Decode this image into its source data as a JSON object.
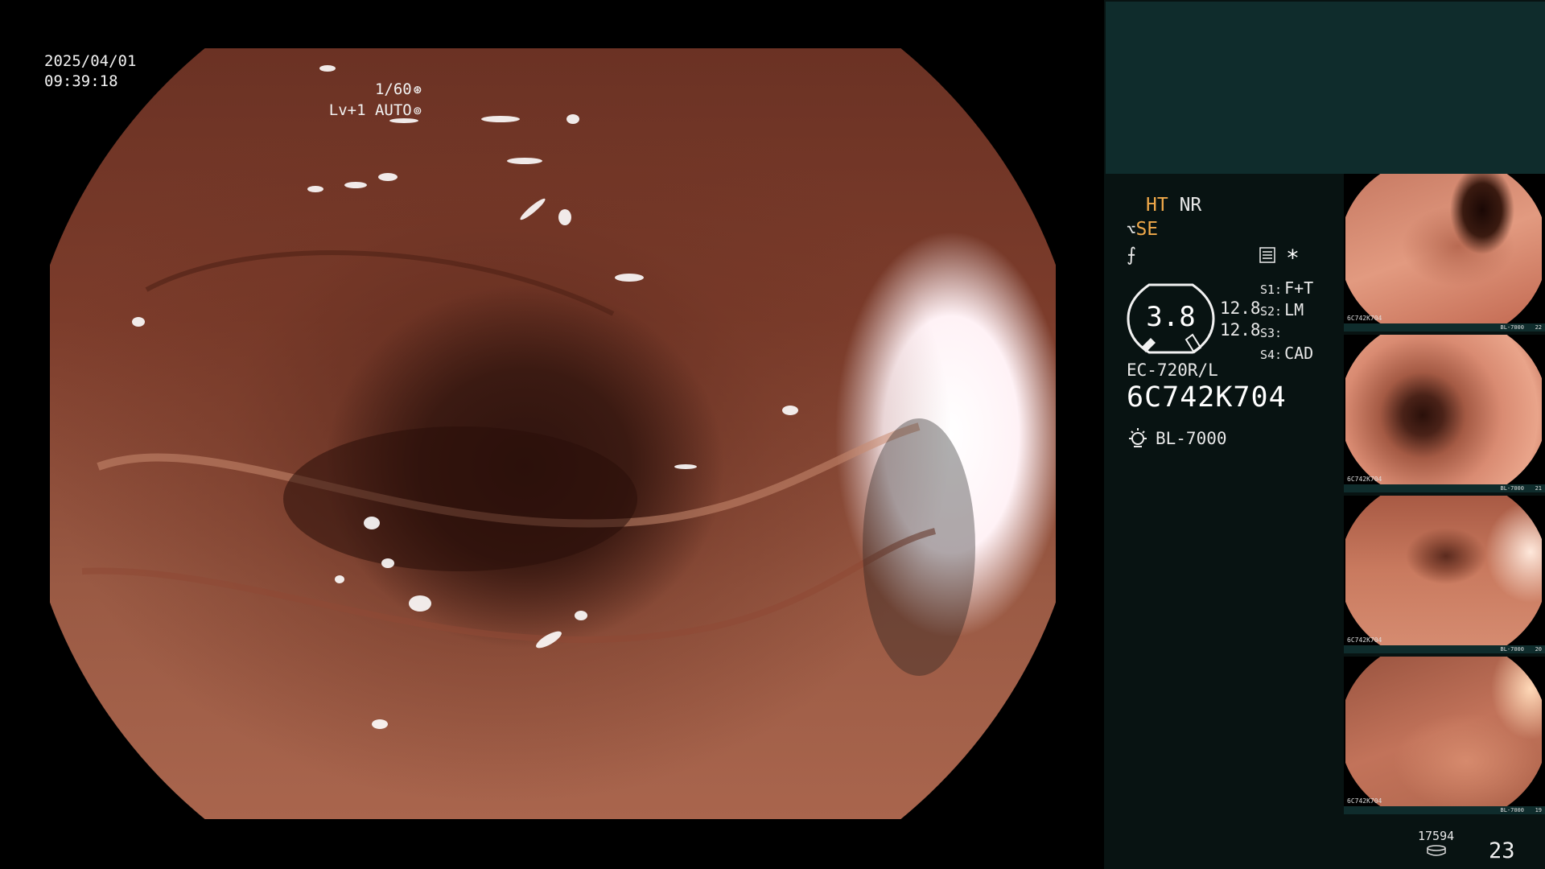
{
  "timestamp": {
    "date": "2025/04/01",
    "time": "09:39:18"
  },
  "video": {
    "shutter": "1/60",
    "level": "Lv+1",
    "iris_mode": "AUTO"
  },
  "image_processing": {
    "ht_label": "HT",
    "nr_label": "NR",
    "se_label": "SE",
    "fs_label": "⨍",
    "asterisk": "*"
  },
  "gauge": {
    "value": "3.8",
    "reading_1": "12.8",
    "reading_2": "12.8"
  },
  "scope_settings": [
    {
      "key": "S1:",
      "value": "F+T"
    },
    {
      "key": "S2:",
      "value": "LM"
    },
    {
      "key": "S3:",
      "value": ""
    },
    {
      "key": "S4:",
      "value": "CAD"
    }
  ],
  "scope": {
    "model": "EC-720R/L",
    "serial": "6C742K704"
  },
  "light_source": {
    "model": "BL-7000",
    "icon": "light-bulb-icon"
  },
  "thumbnails": [
    {
      "serial": "6C742K704",
      "lamp": "BL-7000",
      "index": "22"
    },
    {
      "serial": "6C742K704",
      "lamp": "BL-7000",
      "index": "21"
    },
    {
      "serial": "6C742K704",
      "lamp": "BL-7000",
      "index": "20"
    },
    {
      "serial": "6C742K704",
      "lamp": "BL-7000",
      "index": "19"
    }
  ],
  "footer": {
    "storage_count": "17594",
    "page_number": "23"
  },
  "colors": {
    "accent_orange": "#f0a94a",
    "panel_teal": "#0f2c2c",
    "panel_dark": "#081312"
  }
}
